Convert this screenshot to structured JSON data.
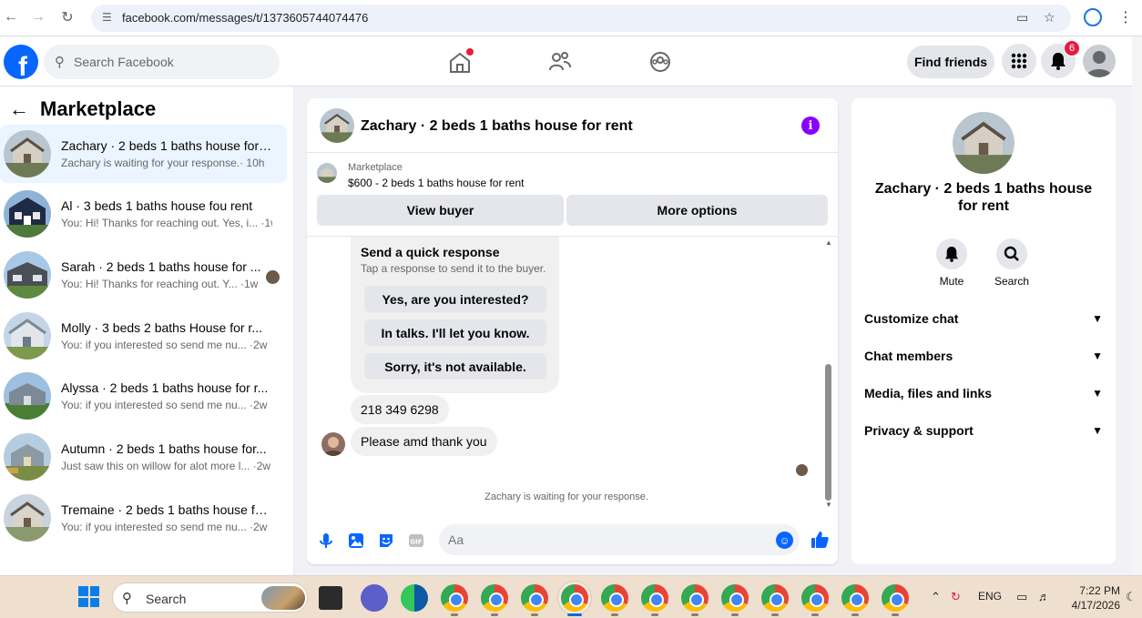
{
  "browser": {
    "url": "facebook.com/messages/t/1373605744074476"
  },
  "fb": {
    "search_placeholder": "Search Facebook",
    "find_friends": "Find friends",
    "notif_count": "6"
  },
  "marketplace": {
    "title": "Marketplace",
    "conversations": [
      {
        "name": "Zachary · 2 beds 1 baths house for ...",
        "preview": "Zachary is waiting for your response.· 10h",
        "active": true
      },
      {
        "name": "Al · 3 beds 1 baths house fou rent",
        "preview": "You: Hi! Thanks for reaching out. Yes, i... ·1w"
      },
      {
        "name": "Sarah · 2 beds 1 baths house for ...",
        "preview": "You: Hi! Thanks for reaching out. Y... ·1w"
      },
      {
        "name": "Molly · 3 beds 2 baths House for r...",
        "preview": "You: if you interested so send me nu... ·2w"
      },
      {
        "name": "Alyssa · 2 beds 1 baths house for r...",
        "preview": "You: if you interested so send me nu... ·2w"
      },
      {
        "name": "Autumn · 2 beds 1 baths house for...",
        "preview": "Just saw this on willow for alot more l... ·2w"
      },
      {
        "name": "Tremaine · 2 beds 1 baths house fo...",
        "preview": "You: if you interested so send me nu... ·2w"
      }
    ]
  },
  "chat": {
    "title": "Zachary · 2 beds 1 baths house for rent",
    "listing_label": "Marketplace",
    "listing_price": "$600 - 2 beds 1 baths house for rent",
    "view_buyer": "View buyer",
    "more_options": "More options",
    "quick_title": "Send a quick response",
    "quick_sub": "Tap a response to send it to the buyer.",
    "quick_options": [
      "Yes, are you interested?",
      "In talks. I'll let you know.",
      "Sorry, it's not available."
    ],
    "msg_phone": "218 349 6298",
    "msg_reply": "Please amd thank you",
    "waiting": "Zachary is waiting for your response.",
    "input_placeholder": "Aa"
  },
  "info_panel": {
    "name": "Zachary · 2 beds 1 baths house for rent",
    "mute": "Mute",
    "search": "Search",
    "rows": [
      "Customize chat",
      "Chat members",
      "Media, files and links",
      "Privacy & support"
    ]
  },
  "taskbar": {
    "search_placeholder": "Search",
    "lang": "ENG",
    "time": "7:22 PM",
    "date": "4/17/2026"
  }
}
